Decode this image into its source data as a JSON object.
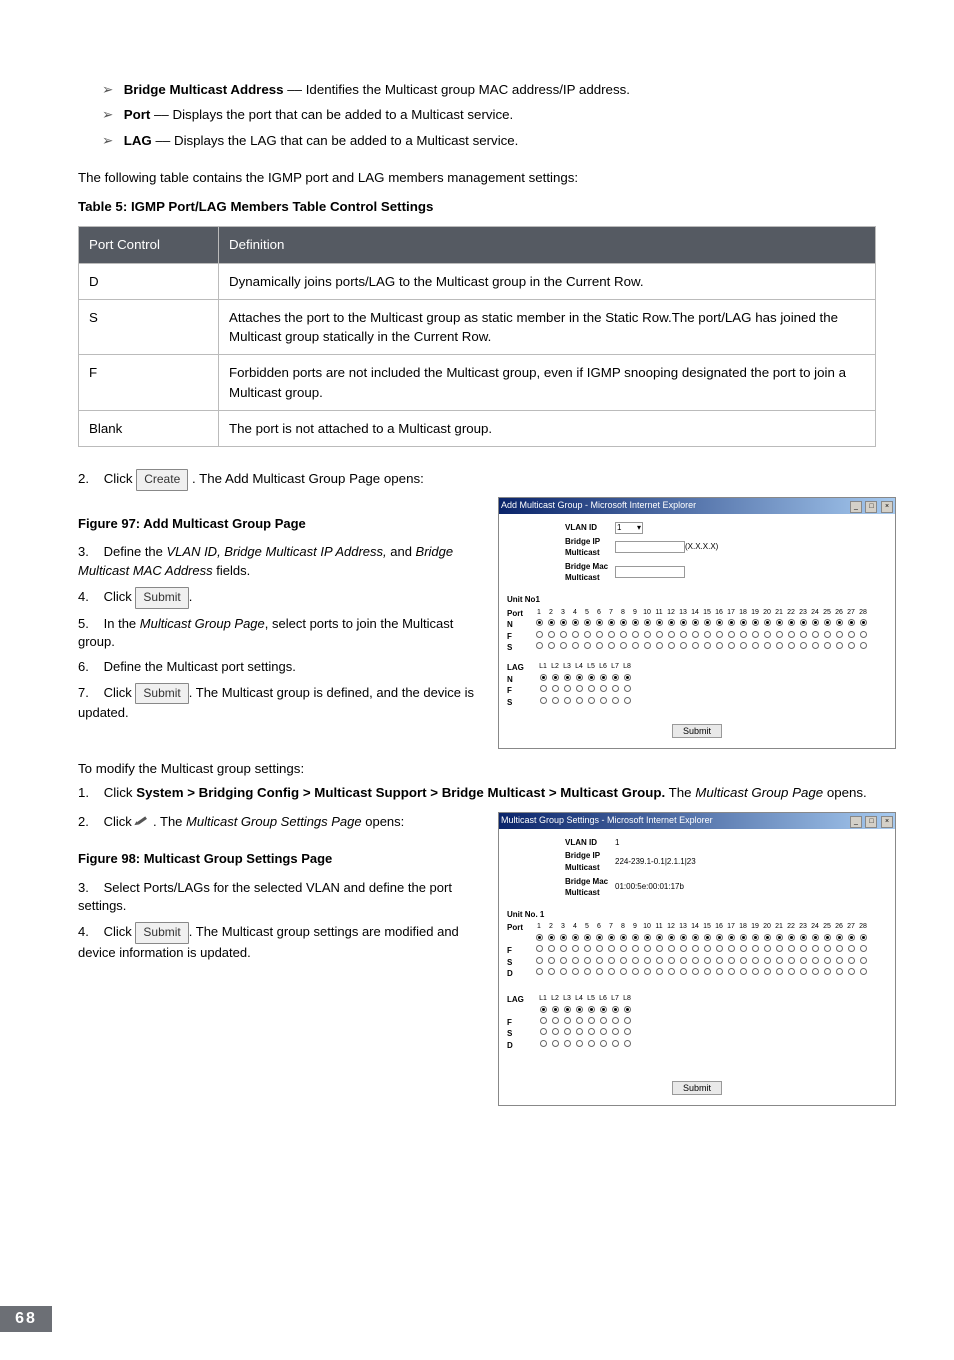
{
  "bullets": [
    {
      "term": "Bridge Multicast Address",
      "desc": " –– Identifies the Multicast group MAC address/IP address."
    },
    {
      "term": "Port",
      "desc": " –– Displays the port that can be added to a Multicast service."
    },
    {
      "term": "LAG",
      "desc": " –– Displays the LAG that can be added to a Multicast service."
    }
  ],
  "para_intro": "The following table contains the IGMP port and LAG members management settings:",
  "table_caption": "Table 5: IGMP Port/LAG Members Table Control Settings",
  "table": {
    "headers": [
      "Port Control",
      "Definition"
    ],
    "rows": [
      [
        "D",
        "Dynamically joins ports/LAG to the Multicast group in the Current Row."
      ],
      [
        "S",
        "Attaches the port to the Multicast group as static member in the Static Row.The port/LAG has joined the Multicast group statically in the Current Row."
      ],
      [
        "F",
        "Forbidden ports are not included the Multicast group, even if IGMP snooping designated the port to join a Multicast group."
      ],
      [
        "Blank",
        "The port is not attached to a Multicast group."
      ]
    ]
  },
  "step2": {
    "num": "2.",
    "pre": "Click ",
    "btn": "Create",
    "post": ". The Add Multicast Group Page opens:"
  },
  "fig97_caption": "Figure 97: Add Multicast Group Page",
  "leftsteps": [
    {
      "num": "3.",
      "html_parts": [
        "Define the ",
        "VLAN ID, Bridge Multicast IP Address,",
        " and ",
        "Bridge Multicast MAC Address",
        " fields."
      ]
    },
    {
      "num": "4.",
      "pre": "Click ",
      "btn": "Submit",
      "post": "."
    },
    {
      "num": "5.",
      "html_parts": [
        "In the ",
        "Multicast Group Page",
        ", select ports to join the Multicast group."
      ]
    },
    {
      "num": "6.",
      "plain": "Define the Multicast port settings."
    },
    {
      "num": "7.",
      "pre": "Click ",
      "btn": "Submit",
      "post": ". The Multicast group is defined, and the device is updated."
    }
  ],
  "modify_intro": "To modify the Multicast group settings:",
  "modify_step1": {
    "num": "1.",
    "pre": " Click ",
    "bold": "System > Bridging Config > Multicast Support > Bridge Multicast > Multicast Group.",
    "mid": " The ",
    "ital": "Multicast Group Page",
    "post": " opens."
  },
  "modify_step2": {
    "num": "2.",
    "pre": "Click  ",
    "post": " . The ",
    "ital": "Multicast Group Settings Page",
    "post2": " opens:"
  },
  "fig98_caption": "Figure 98: Multicast Group Settings Page",
  "leftsteps2": [
    {
      "num": "3.",
      "plain": " Select Ports/LAGs for the selected VLAN and define the port settings."
    },
    {
      "num": "4.",
      "pre": "Click ",
      "btn": "Submit",
      "post": ". The Multicast group settings are modified and device information is updated."
    }
  ],
  "win97": {
    "title": "Add Multicast Group - Microsoft Internet Explorer",
    "fields": {
      "vlan_id_lbl": "VLAN ID",
      "vlan_id_val": "1",
      "bip_lbl": "Bridge IP Multicast",
      "bip_val": "(X.X.X.X)",
      "bmac_lbl": "Bridge Mac Multicast"
    },
    "unit": "Unit No1",
    "port_hdr": "Port",
    "cols28": [
      "1",
      "2",
      "3",
      "4",
      "5",
      "6",
      "7",
      "8",
      "9",
      "10",
      "11",
      "12",
      "13",
      "14",
      "15",
      "16",
      "17",
      "18",
      "19",
      "20",
      "21",
      "22",
      "23",
      "24",
      "25",
      "26",
      "27",
      "28"
    ],
    "rowlabels3": [
      "N",
      "F",
      "S"
    ],
    "lag_hdr": "LAG",
    "lagcols": [
      "L1",
      "L2",
      "L3",
      "L4",
      "L5",
      "L6",
      "L7",
      "L8"
    ],
    "submit": "Submit"
  },
  "win98": {
    "title": "Multicast Group Settings - Microsoft Internet Explorer",
    "fields": {
      "vlan_id_lbl": "VLAN ID",
      "vlan_id_val": "1",
      "bip_lbl": "Bridge IP Multicast",
      "bip_val": "224-239.1-0.1|2.1.1|23",
      "bmac_lbl": "Bridge Mac Multicast",
      "bmac_val": "01:00:5e:00:01:17b"
    },
    "unit": "Unit No. 1",
    "port_hdr": "Port",
    "cols28": [
      "1",
      "2",
      "3",
      "4",
      "5",
      "6",
      "7",
      "8",
      "9",
      "10",
      "11",
      "12",
      "13",
      "14",
      "15",
      "16",
      "17",
      "18",
      "19",
      "20",
      "21",
      "22",
      "23",
      "24",
      "25",
      "26",
      "27",
      "28"
    ],
    "rowlabels4": [
      " ",
      "F",
      "S",
      "D"
    ],
    "lag_hdr": "LAG",
    "lagcols": [
      "L1",
      "L2",
      "L3",
      "L4",
      "L5",
      "L6",
      "L7",
      "L8"
    ],
    "submit": "Submit"
  },
  "page_number": "68"
}
